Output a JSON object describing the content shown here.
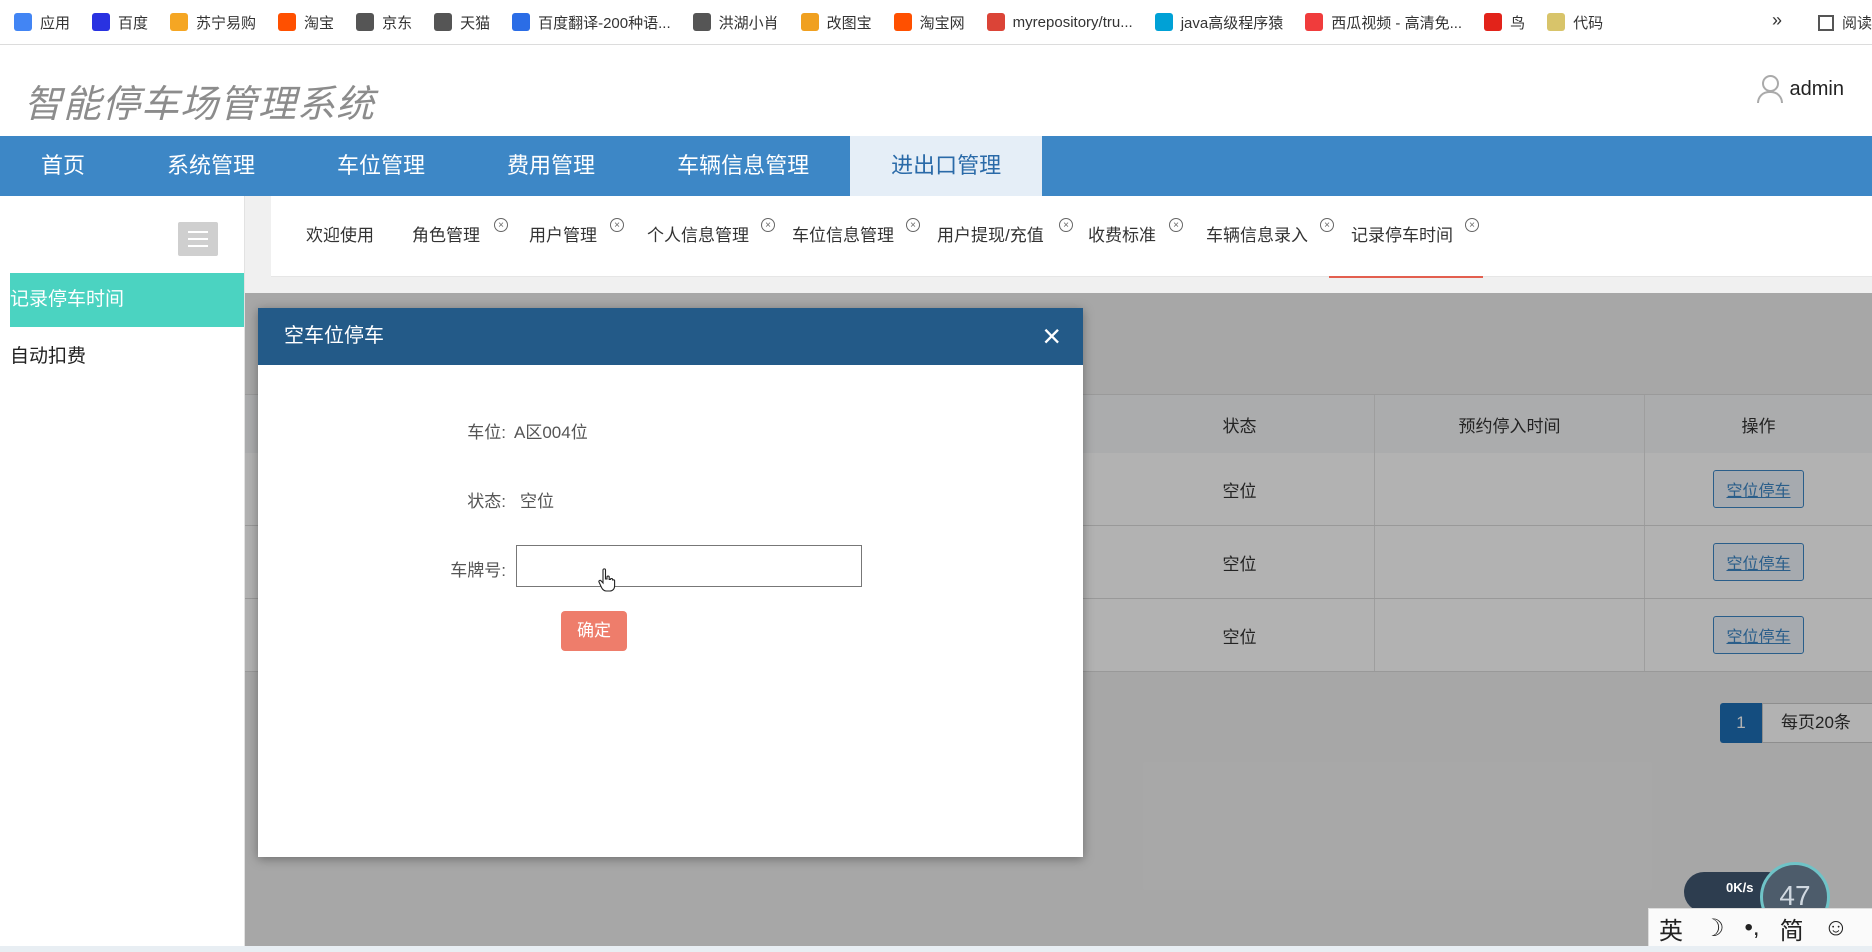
{
  "bookmarks": [
    {
      "label": "应用",
      "icon": "apps-grid-icon",
      "color": "#4285f4"
    },
    {
      "label": "百度",
      "icon": "baidu-paw-icon",
      "color": "#2932e1"
    },
    {
      "label": "苏宁易购",
      "icon": "suning-icon",
      "color": "#f5a623"
    },
    {
      "label": "淘宝",
      "icon": "taobao-icon",
      "color": "#ff5000"
    },
    {
      "label": "京东",
      "icon": "globe-icon",
      "color": "#555555"
    },
    {
      "label": "天猫",
      "icon": "globe-icon",
      "color": "#555555"
    },
    {
      "label": "百度翻译-200种语...",
      "icon": "translate-icon",
      "color": "#2b6de6"
    },
    {
      "label": "洪湖小肖",
      "icon": "feather-icon",
      "color": "#555555"
    },
    {
      "label": "改图宝",
      "icon": "gaitubao-icon",
      "color": "#f0a020"
    },
    {
      "label": "淘宝网",
      "icon": "taobao-icon",
      "color": "#ff5000"
    },
    {
      "label": "myrepository/tru...",
      "icon": "chrome-icon",
      "color": "#db4437"
    },
    {
      "label": "java高级程序猿",
      "icon": "bilibili-icon",
      "color": "#00a1d6"
    },
    {
      "label": "西瓜视频 - 高清免...",
      "icon": "xigua-icon",
      "color": "#f03c3c"
    },
    {
      "label": "鸟",
      "icon": "bird-icon",
      "color": "#e2231a"
    },
    {
      "label": "代码",
      "icon": "code-icon",
      "color": "#d8c46a"
    }
  ],
  "bookmarks_more": "»",
  "bookmarks_reader": "阅读",
  "header": {
    "logo": "智能停车场管理系统",
    "user": "admin"
  },
  "mainnav": [
    "首页",
    "系统管理",
    "车位管理",
    "费用管理",
    "车辆信息管理",
    "进出口管理"
  ],
  "sidebar": [
    "记录停车时间",
    "自动扣费"
  ],
  "tabs": [
    {
      "label": "欢迎使用",
      "closable": false
    },
    {
      "label": "角色管理",
      "closable": true
    },
    {
      "label": "用户管理",
      "closable": true
    },
    {
      "label": "个人信息管理",
      "closable": true
    },
    {
      "label": "车位信息管理",
      "closable": true
    },
    {
      "label": "用户提现/充值",
      "closable": true
    },
    {
      "label": "收费标准",
      "closable": true
    },
    {
      "label": "车辆信息录入",
      "closable": true
    },
    {
      "label": "记录停车时间",
      "closable": true
    }
  ],
  "tab_close_glyph": "×",
  "table": {
    "headers": [
      "状态",
      "预约停入时间",
      "操作"
    ],
    "rows": [
      {
        "status": "空位",
        "reserve_time": "",
        "action": "空位停车"
      },
      {
        "status": "空位",
        "reserve_time": "",
        "action": "空位停车"
      },
      {
        "status": "空位",
        "reserve_time": "",
        "action": "空位停车"
      }
    ]
  },
  "pager": {
    "page": "1",
    "page_size": "每页20条"
  },
  "modal": {
    "title": "空车位停车",
    "close": "×",
    "space_label": "车位:",
    "space_value": "A区004位",
    "status_label": "状态:",
    "status_value": "空位",
    "plate_label": "车牌号:",
    "plate_value": "",
    "confirm": "确定"
  },
  "widgets": {
    "speed": "0K/s",
    "gauge": "47",
    "ime": [
      "英",
      "☽",
      "•,",
      "简",
      "☺"
    ]
  }
}
